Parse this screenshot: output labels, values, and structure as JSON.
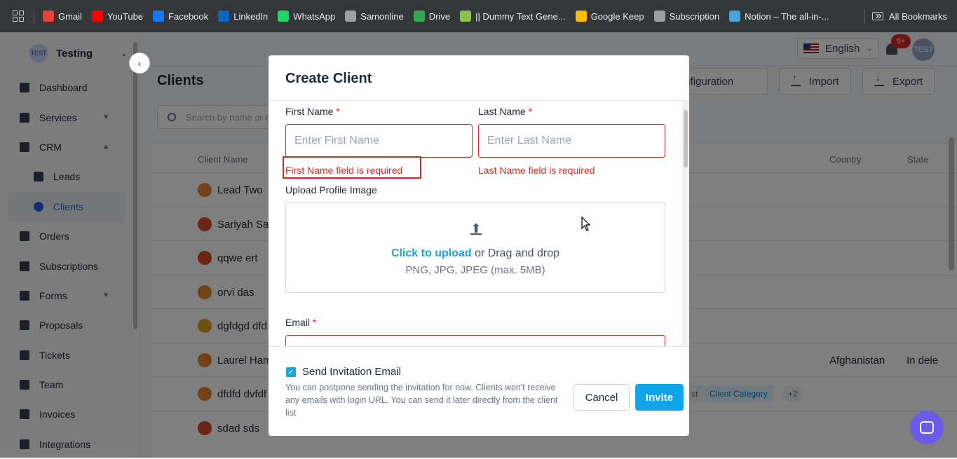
{
  "bookmarks": {
    "items": [
      {
        "label": "Gmail",
        "icon": "gmail-icon",
        "color": "#ea4335"
      },
      {
        "label": "YouTube",
        "icon": "youtube-icon",
        "color": "#ff0000"
      },
      {
        "label": "Facebook",
        "icon": "facebook-icon",
        "color": "#1877f2"
      },
      {
        "label": "LinkedIn",
        "icon": "linkedin-icon",
        "color": "#0a66c2"
      },
      {
        "label": "WhatsApp",
        "icon": "whatsapp-icon",
        "color": "#25d366"
      },
      {
        "label": "Samonline",
        "icon": "globe-icon",
        "color": "#9aa0a6"
      },
      {
        "label": "Drive",
        "icon": "drive-icon",
        "color": "#34a853"
      },
      {
        "label": "|| Dummy Text Gene...",
        "icon": "dummy-text-icon",
        "color": "#8bc34a"
      },
      {
        "label": "Google Keep",
        "icon": "keep-icon",
        "color": "#fbbc04"
      },
      {
        "label": "Subscription",
        "icon": "globe-icon",
        "color": "#9aa0a6"
      },
      {
        "label": "Notion – The all-in-...",
        "icon": "notion-icon",
        "color": "#4aa3df"
      }
    ],
    "more": "»",
    "all_bookmarks": "All Bookmarks"
  },
  "sidebar": {
    "workspace_avatar": "TEST",
    "workspace_name": "Testing",
    "items": [
      {
        "label": "Dashboard"
      },
      {
        "label": "Services"
      },
      {
        "label": "CRM"
      },
      {
        "label": "Leads"
      },
      {
        "label": "Clients"
      },
      {
        "label": "Orders"
      },
      {
        "label": "Subscriptions"
      },
      {
        "label": "Forms"
      },
      {
        "label": "Proposals"
      },
      {
        "label": "Tickets"
      },
      {
        "label": "Team"
      },
      {
        "label": "Invoices"
      },
      {
        "label": "Integrations"
      }
    ]
  },
  "header": {
    "language": "English",
    "notifications": "9+",
    "user_avatar": "TEST"
  },
  "page": {
    "title": "Clients",
    "configuration": "Configuration",
    "import": "Import",
    "export": "Export",
    "search_placeholder": "Search by name or e"
  },
  "table": {
    "columns": {
      "name": "Client Name",
      "country": "Country",
      "state": "State"
    },
    "rows": [
      {
        "name": "Lead Two",
        "country": "",
        "state": ""
      },
      {
        "name": "Sariyah Sar",
        "country": "",
        "state": ""
      },
      {
        "name": "qqwe ert",
        "country": "",
        "state": ""
      },
      {
        "name": "orvi das",
        "country": "",
        "state": ""
      },
      {
        "name": "dgfdgd dfd",
        "country": "",
        "state": ""
      },
      {
        "name": "Laurel Ham",
        "country": "Afghanistan",
        "state": "In dele"
      },
      {
        "name": "dfdfd dvfdf",
        "country": "",
        "state": ""
      },
      {
        "name": "sdad sds",
        "country": "",
        "state": ""
      }
    ],
    "chips": {
      "partial": "st",
      "category": "Client Category",
      "more": "+2"
    }
  },
  "modal": {
    "title": "Create Client",
    "first_name_label": "First Name",
    "last_name_label": "Last Name",
    "required_mark": "*",
    "first_name_placeholder": "Enter First Name",
    "last_name_placeholder": "Enter Last Name",
    "first_name_error": "First Name field is required",
    "last_name_error": "Last Name field is required",
    "upload_label": "Upload Profile Image",
    "upload_link": "Click to upload",
    "upload_text": " or Drag and drop",
    "upload_formats": "PNG, JPG, JPEG (max. 5MB)",
    "email_label": "Email",
    "send_invitation": "Send Invitation Email",
    "send_invitation_checked": true,
    "help_text": "You can postpone sending the invitation for now. Clients won't receive any emails with login URL. You can send it later directly from the client list",
    "cancel": "Cancel",
    "invite": "Invite"
  }
}
